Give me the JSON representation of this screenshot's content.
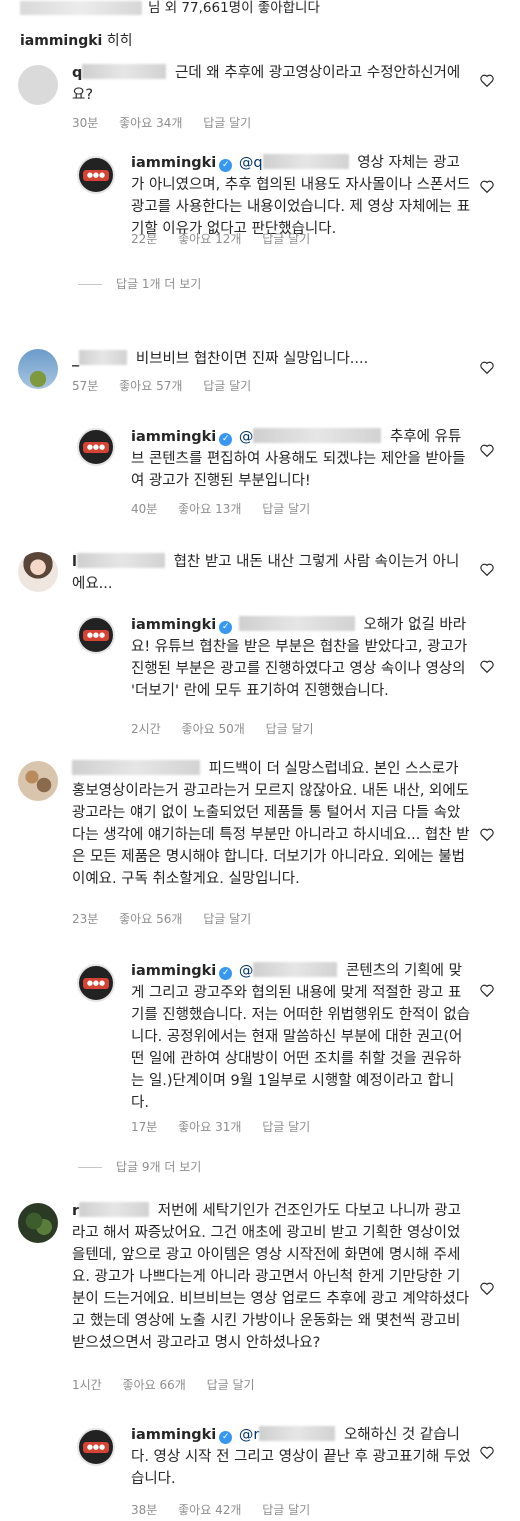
{
  "header": {
    "likes_text": "님 외 77,661명이 좋아합니다",
    "caption_user": "iammingki",
    "caption_text": "히히"
  },
  "labels": {
    "likes_prefix": "좋아요",
    "reply": "답글 달기"
  },
  "comments": [
    {
      "user": "q",
      "text": "근데 왜 추후에 광고영상이라고 수정안하신거에요?",
      "time": "30분",
      "likes": "좋아요 34개"
    },
    {
      "user": "iammingki",
      "mention": "@q",
      "text": "영상 자체는 광고가 아니였으며, 추후 협의된 내용도 자사몰이나 스폰서드 광고를 사용한다는 내용이었습니다. 제 영상 자체에는 표기할 이유가 없다고 판단했습니다.",
      "time": "22분",
      "likes": "좋아요 12개"
    },
    {
      "view_more": "답글 1개 더 보기"
    },
    {
      "user": "_",
      "text": "비브비브 협찬이면 진짜 실망입니다....",
      "time": "57분",
      "likes": "좋아요 57개"
    },
    {
      "user": "iammingki",
      "mention": "@",
      "text": "추후에 유튜브 콘텐츠를 편집하여 사용해도 되겠냐는 제안을 받아들여 광고가 진행된 부분입니다!",
      "time": "40분",
      "likes": "좋아요 13개"
    },
    {
      "user": "l",
      "text": "협찬 받고 내돈 내산 그렇게 사람 속이는거 아니에요...",
      "time": "",
      "likes": ""
    },
    {
      "user": "iammingki",
      "mention": "",
      "text": "오해가 없길 바라요! 유튜브 협찬을 받은 부분은 협찬을 받았다고, 광고가 진행된 부분은 광고를 진행하였다고 영상 속이나 영상의 '더보기' 란에 모두 표기하여 진행했습니다.",
      "time": "2시간",
      "likes": "좋아요 50개"
    },
    {
      "user": "",
      "text": "피드백이 더 실망스럽네요. 본인 스스로가 홍보영상이라는거 광고라는거 모르지 않잖아요. 내돈 내산, 외에도 광고라는 얘기 없이 노출되었던 제품들 통 털어서 지금 다들 속았다는 생각에 얘기하는데 특정 부분만 아니라고 하시네요... 협찬 받은 모든 제품은 명시해야 합니다. 더보기가 아니라요. 외에는 불법이예요. 구독 취소할게요. 실망입니다.",
      "time": "23분",
      "likes": "좋아요 56개"
    },
    {
      "user": "iammingki",
      "mention": "@",
      "text": "콘텐츠의 기획에 맞게 그리고 광고주와 협의된 내용에 맞게 적절한 광고 표기를 진행했습니다. 저는 어떠한 위법행위도 한적이 없습니다. 공정위에서는 현재 말씀하신 부분에 대한 권고(어떤 일에 관하여 상대방이 어떤 조치를 취할 것을 권유하는 일.)단계이며 9월 1일부로 시행할 예정이라고 합니다.",
      "time": "17분",
      "likes": "좋아요 31개"
    },
    {
      "view_more": "답글 9개 더 보기"
    },
    {
      "user": "r",
      "text": "저번에 세탁기인가 건조인가도 다보고 나니까 광고라고 해서 짜증났어요. 그건 애초에 광고비 받고 기획한 영상이었을텐데, 앞으로 광고 아이템은 영상 시작전에 화면에 명시해 주세요. 광고가 나쁘다는게 아니라 광고면서 아닌척 한게 기만당한 기분이 드는거에요. 비브비브는 영상 업로드 추후에 광고 계약하셨다고 했는데 영상에 노출 시킨 가방이나 운동화는 왜 몇천씩 광고비 받으셨으면서 광고라고 명시 안하셨나요?",
      "time": "1시간",
      "likes": "좋아요 66개"
    },
    {
      "user": "iammingki",
      "mention": "@r",
      "text": "오해하신 것 같습니다. 영상 시작 전 그리고 영상이 끝난 후 광고표기해 두었습니다.",
      "time": "38분",
      "likes": "좋아요 42개"
    }
  ]
}
